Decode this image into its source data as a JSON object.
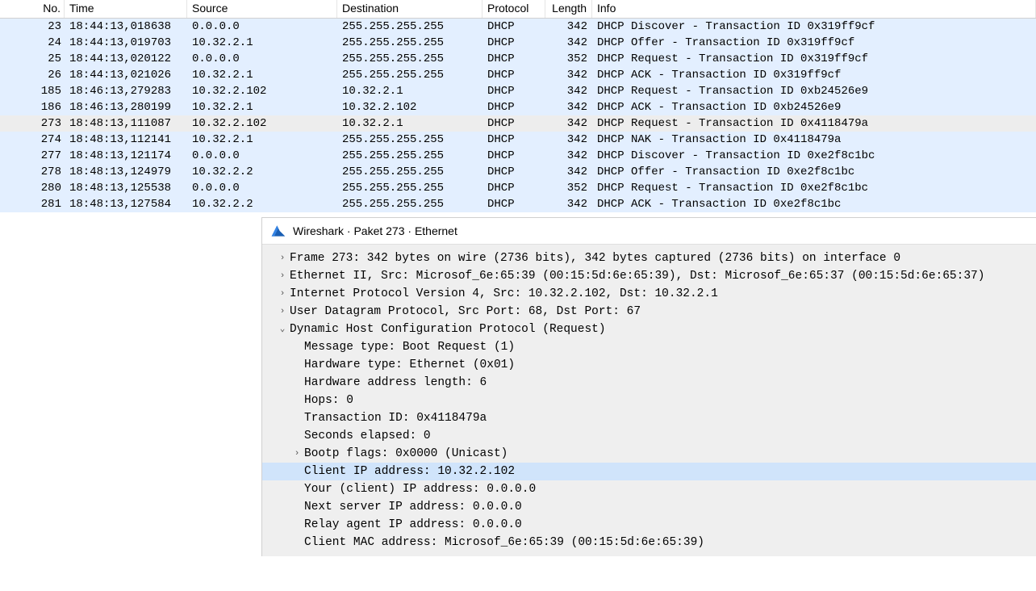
{
  "columns": {
    "no": "No.",
    "time": "Time",
    "source": "Source",
    "destination": "Destination",
    "protocol": "Protocol",
    "length": "Length",
    "info": "Info"
  },
  "packets": [
    {
      "no": "23",
      "time": "18:44:13,018638",
      "src": "0.0.0.0",
      "dst": "255.255.255.255",
      "proto": "DHCP",
      "len": "342",
      "info": "DHCP Discover - Transaction ID 0x319ff9cf",
      "selected": false
    },
    {
      "no": "24",
      "time": "18:44:13,019703",
      "src": "10.32.2.1",
      "dst": "255.255.255.255",
      "proto": "DHCP",
      "len": "342",
      "info": "DHCP Offer    - Transaction ID 0x319ff9cf",
      "selected": false
    },
    {
      "no": "25",
      "time": "18:44:13,020122",
      "src": "0.0.0.0",
      "dst": "255.255.255.255",
      "proto": "DHCP",
      "len": "352",
      "info": "DHCP Request  - Transaction ID 0x319ff9cf",
      "selected": false
    },
    {
      "no": "26",
      "time": "18:44:13,021026",
      "src": "10.32.2.1",
      "dst": "255.255.255.255",
      "proto": "DHCP",
      "len": "342",
      "info": "DHCP ACK      - Transaction ID 0x319ff9cf",
      "selected": false
    },
    {
      "no": "185",
      "time": "18:46:13,279283",
      "src": "10.32.2.102",
      "dst": "10.32.2.1",
      "proto": "DHCP",
      "len": "342",
      "info": "DHCP Request  - Transaction ID 0xb24526e9",
      "selected": false,
      "related": "┌"
    },
    {
      "no": "186",
      "time": "18:46:13,280199",
      "src": "10.32.2.1",
      "dst": "10.32.2.102",
      "proto": "DHCP",
      "len": "342",
      "info": "DHCP ACK      - Transaction ID 0xb24526e9",
      "selected": false,
      "related": "│"
    },
    {
      "no": "273",
      "time": "18:48:13,111087",
      "src": "10.32.2.102",
      "dst": "10.32.2.1",
      "proto": "DHCP",
      "len": "342",
      "info": "DHCP Request  - Transaction ID 0x4118479a",
      "selected": true,
      "related": "└"
    },
    {
      "no": "274",
      "time": "18:48:13,112141",
      "src": "10.32.2.1",
      "dst": "255.255.255.255",
      "proto": "DHCP",
      "len": "342",
      "info": "DHCP NAK      - Transaction ID 0x4118479a",
      "selected": false
    },
    {
      "no": "277",
      "time": "18:48:13,121174",
      "src": "0.0.0.0",
      "dst": "255.255.255.255",
      "proto": "DHCP",
      "len": "342",
      "info": "DHCP Discover - Transaction ID 0xe2f8c1bc",
      "selected": false
    },
    {
      "no": "278",
      "time": "18:48:13,124979",
      "src": "10.32.2.2",
      "dst": "255.255.255.255",
      "proto": "DHCP",
      "len": "342",
      "info": "DHCP Offer    - Transaction ID 0xe2f8c1bc",
      "selected": false
    },
    {
      "no": "280",
      "time": "18:48:13,125538",
      "src": "0.0.0.0",
      "dst": "255.255.255.255",
      "proto": "DHCP",
      "len": "352",
      "info": "DHCP Request  - Transaction ID 0xe2f8c1bc",
      "selected": false
    },
    {
      "no": "281",
      "time": "18:48:13,127584",
      "src": "10.32.2.2",
      "dst": "255.255.255.255",
      "proto": "DHCP",
      "len": "342",
      "info": "DHCP ACK      - Transaction ID 0xe2f8c1bc",
      "selected": false
    }
  ],
  "details": {
    "window_title": "Wireshark · Paket 273 · Ethernet",
    "frame": "Frame 273: 342 bytes on wire (2736 bits), 342 bytes captured (2736 bits) on interface 0",
    "eth": "Ethernet II, Src: Microsof_6e:65:39 (00:15:5d:6e:65:39), Dst: Microsof_6e:65:37 (00:15:5d:6e:65:37)",
    "ip": "Internet Protocol Version 4, Src: 10.32.2.102, Dst: 10.32.2.1",
    "udp": "User Datagram Protocol, Src Port: 68, Dst Port: 67",
    "dhcp_header": "Dynamic Host Configuration Protocol (Request)",
    "dhcp": {
      "msg_type": "Message type: Boot Request (1)",
      "hw_type": "Hardware type: Ethernet (0x01)",
      "hw_len": "Hardware address length: 6",
      "hops": "Hops: 0",
      "txid": "Transaction ID: 0x4118479a",
      "secs": "Seconds elapsed: 0",
      "flags": "Bootp flags: 0x0000 (Unicast)",
      "ciaddr": "Client IP address: 10.32.2.102",
      "yiaddr": "Your (client) IP address: 0.0.0.0",
      "siaddr": "Next server IP address: 0.0.0.0",
      "giaddr": "Relay agent IP address: 0.0.0.0",
      "chaddr": "Client MAC address: Microsof_6e:65:39 (00:15:5d:6e:65:39)"
    }
  },
  "glyphs": {
    "collapsed": "›",
    "expanded": "⌄"
  }
}
